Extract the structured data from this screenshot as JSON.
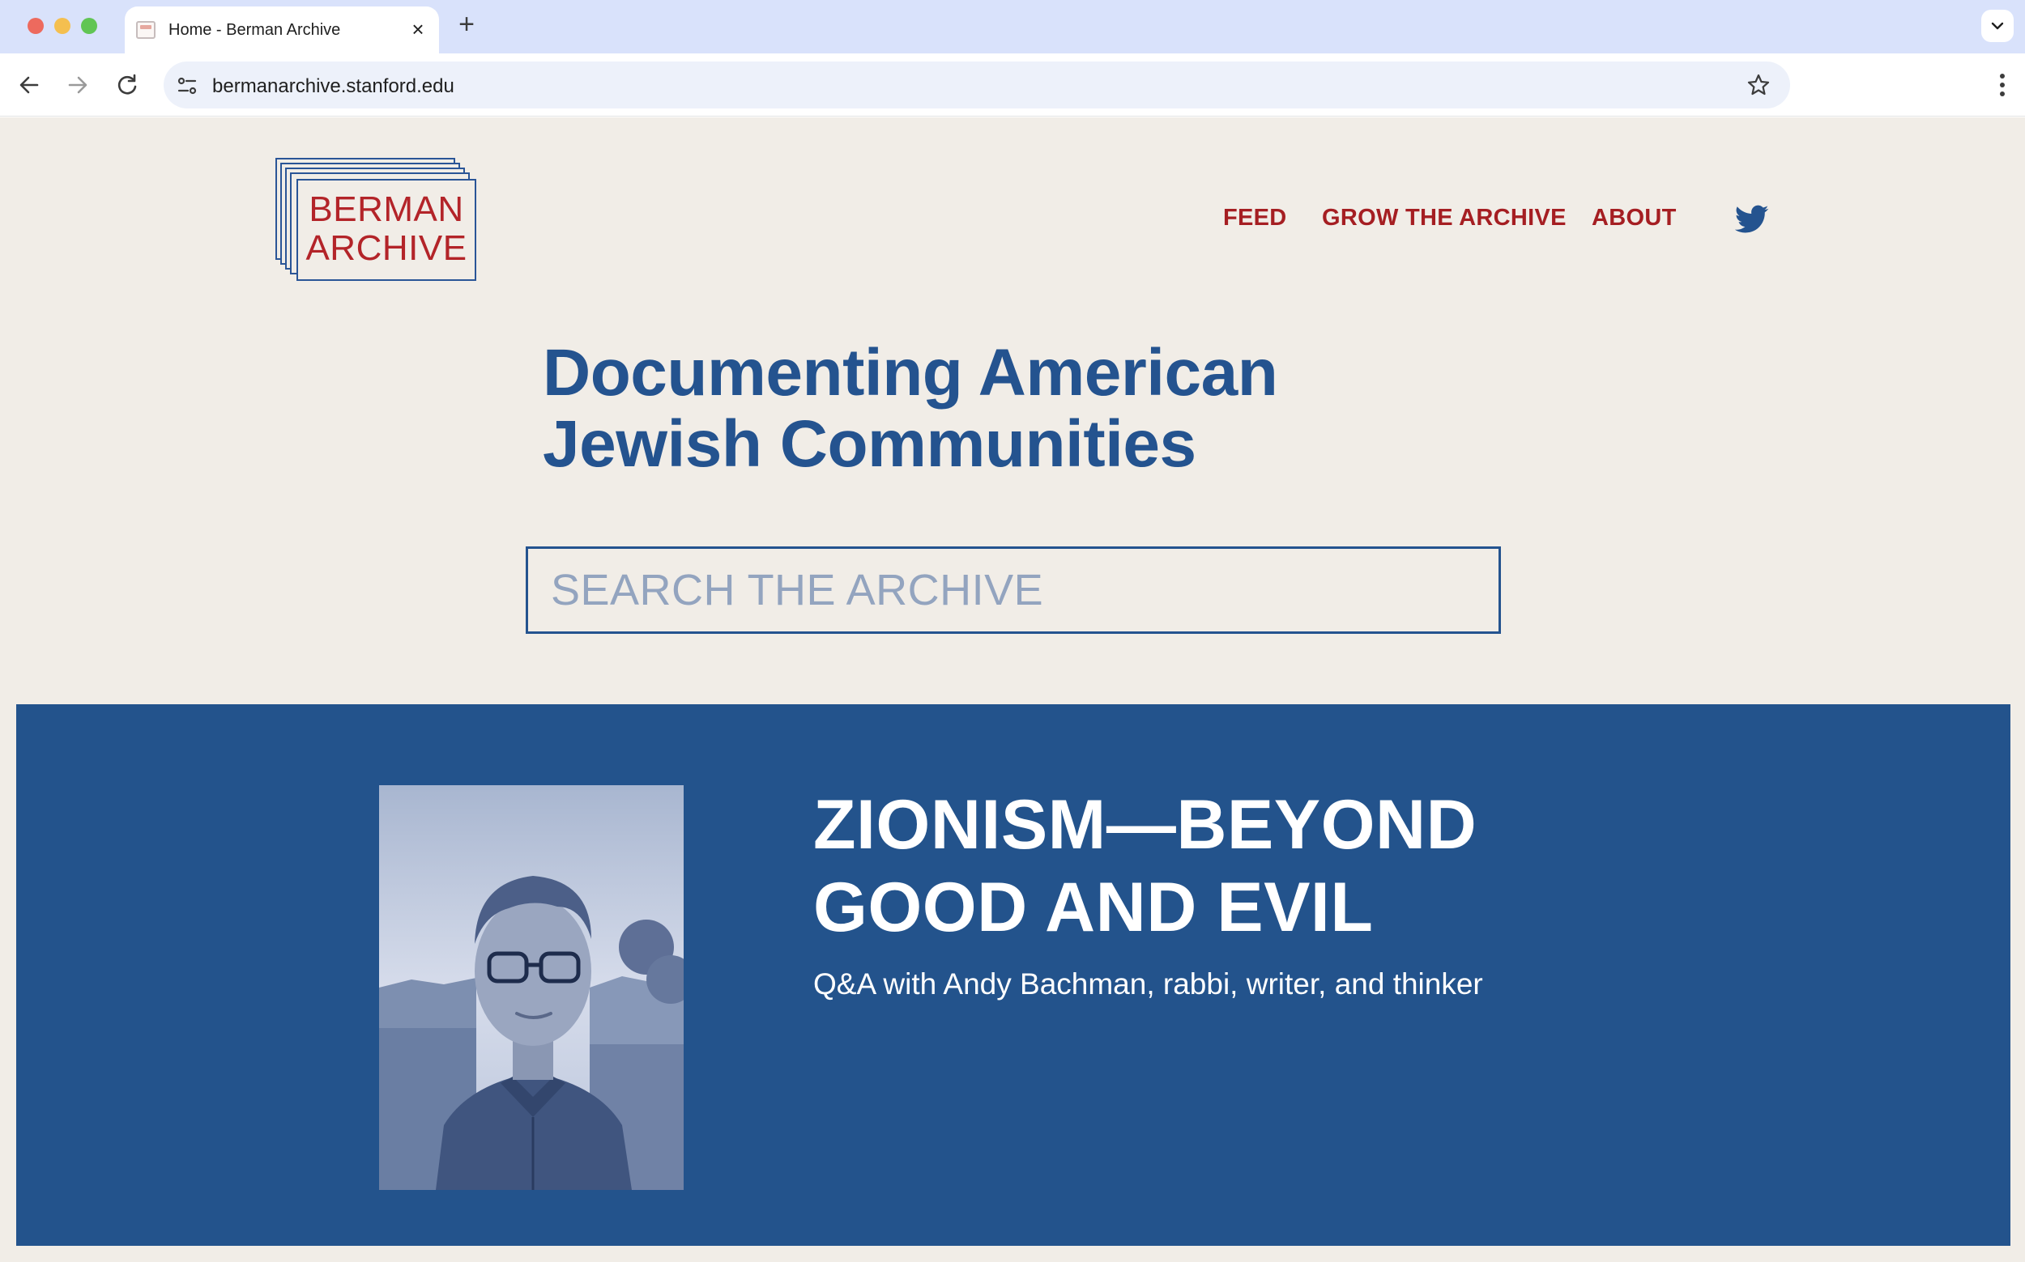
{
  "browser": {
    "tab_title": "Home - Berman Archive",
    "tab_close": "×",
    "new_tab": "+",
    "url": "bermanarchive.stanford.edu"
  },
  "logo": {
    "line1": "BERMAN",
    "line2": "ARCHIVE"
  },
  "nav": {
    "items": [
      "FEED",
      "GROW THE ARCHIVE",
      "ABOUT"
    ],
    "social_icon": "twitter-icon"
  },
  "hero": {
    "headline_line1": "Documenting American",
    "headline_line2": "Jewish Communities"
  },
  "search": {
    "placeholder": "SEARCH THE ARCHIVE",
    "value": ""
  },
  "feature": {
    "title_line1": "ZIONISM—BEYOND",
    "title_line2": "GOOD AND EVIL",
    "subtitle": "Q&A with Andy Bachman, rabbi, writer, and thinker"
  },
  "colors": {
    "page_bg": "#f1ede7",
    "brand_blue": "#24538f",
    "brand_red": "#a51e22",
    "feature_bg": "#23538c",
    "tabstrip_bg": "#d9e2fb"
  }
}
